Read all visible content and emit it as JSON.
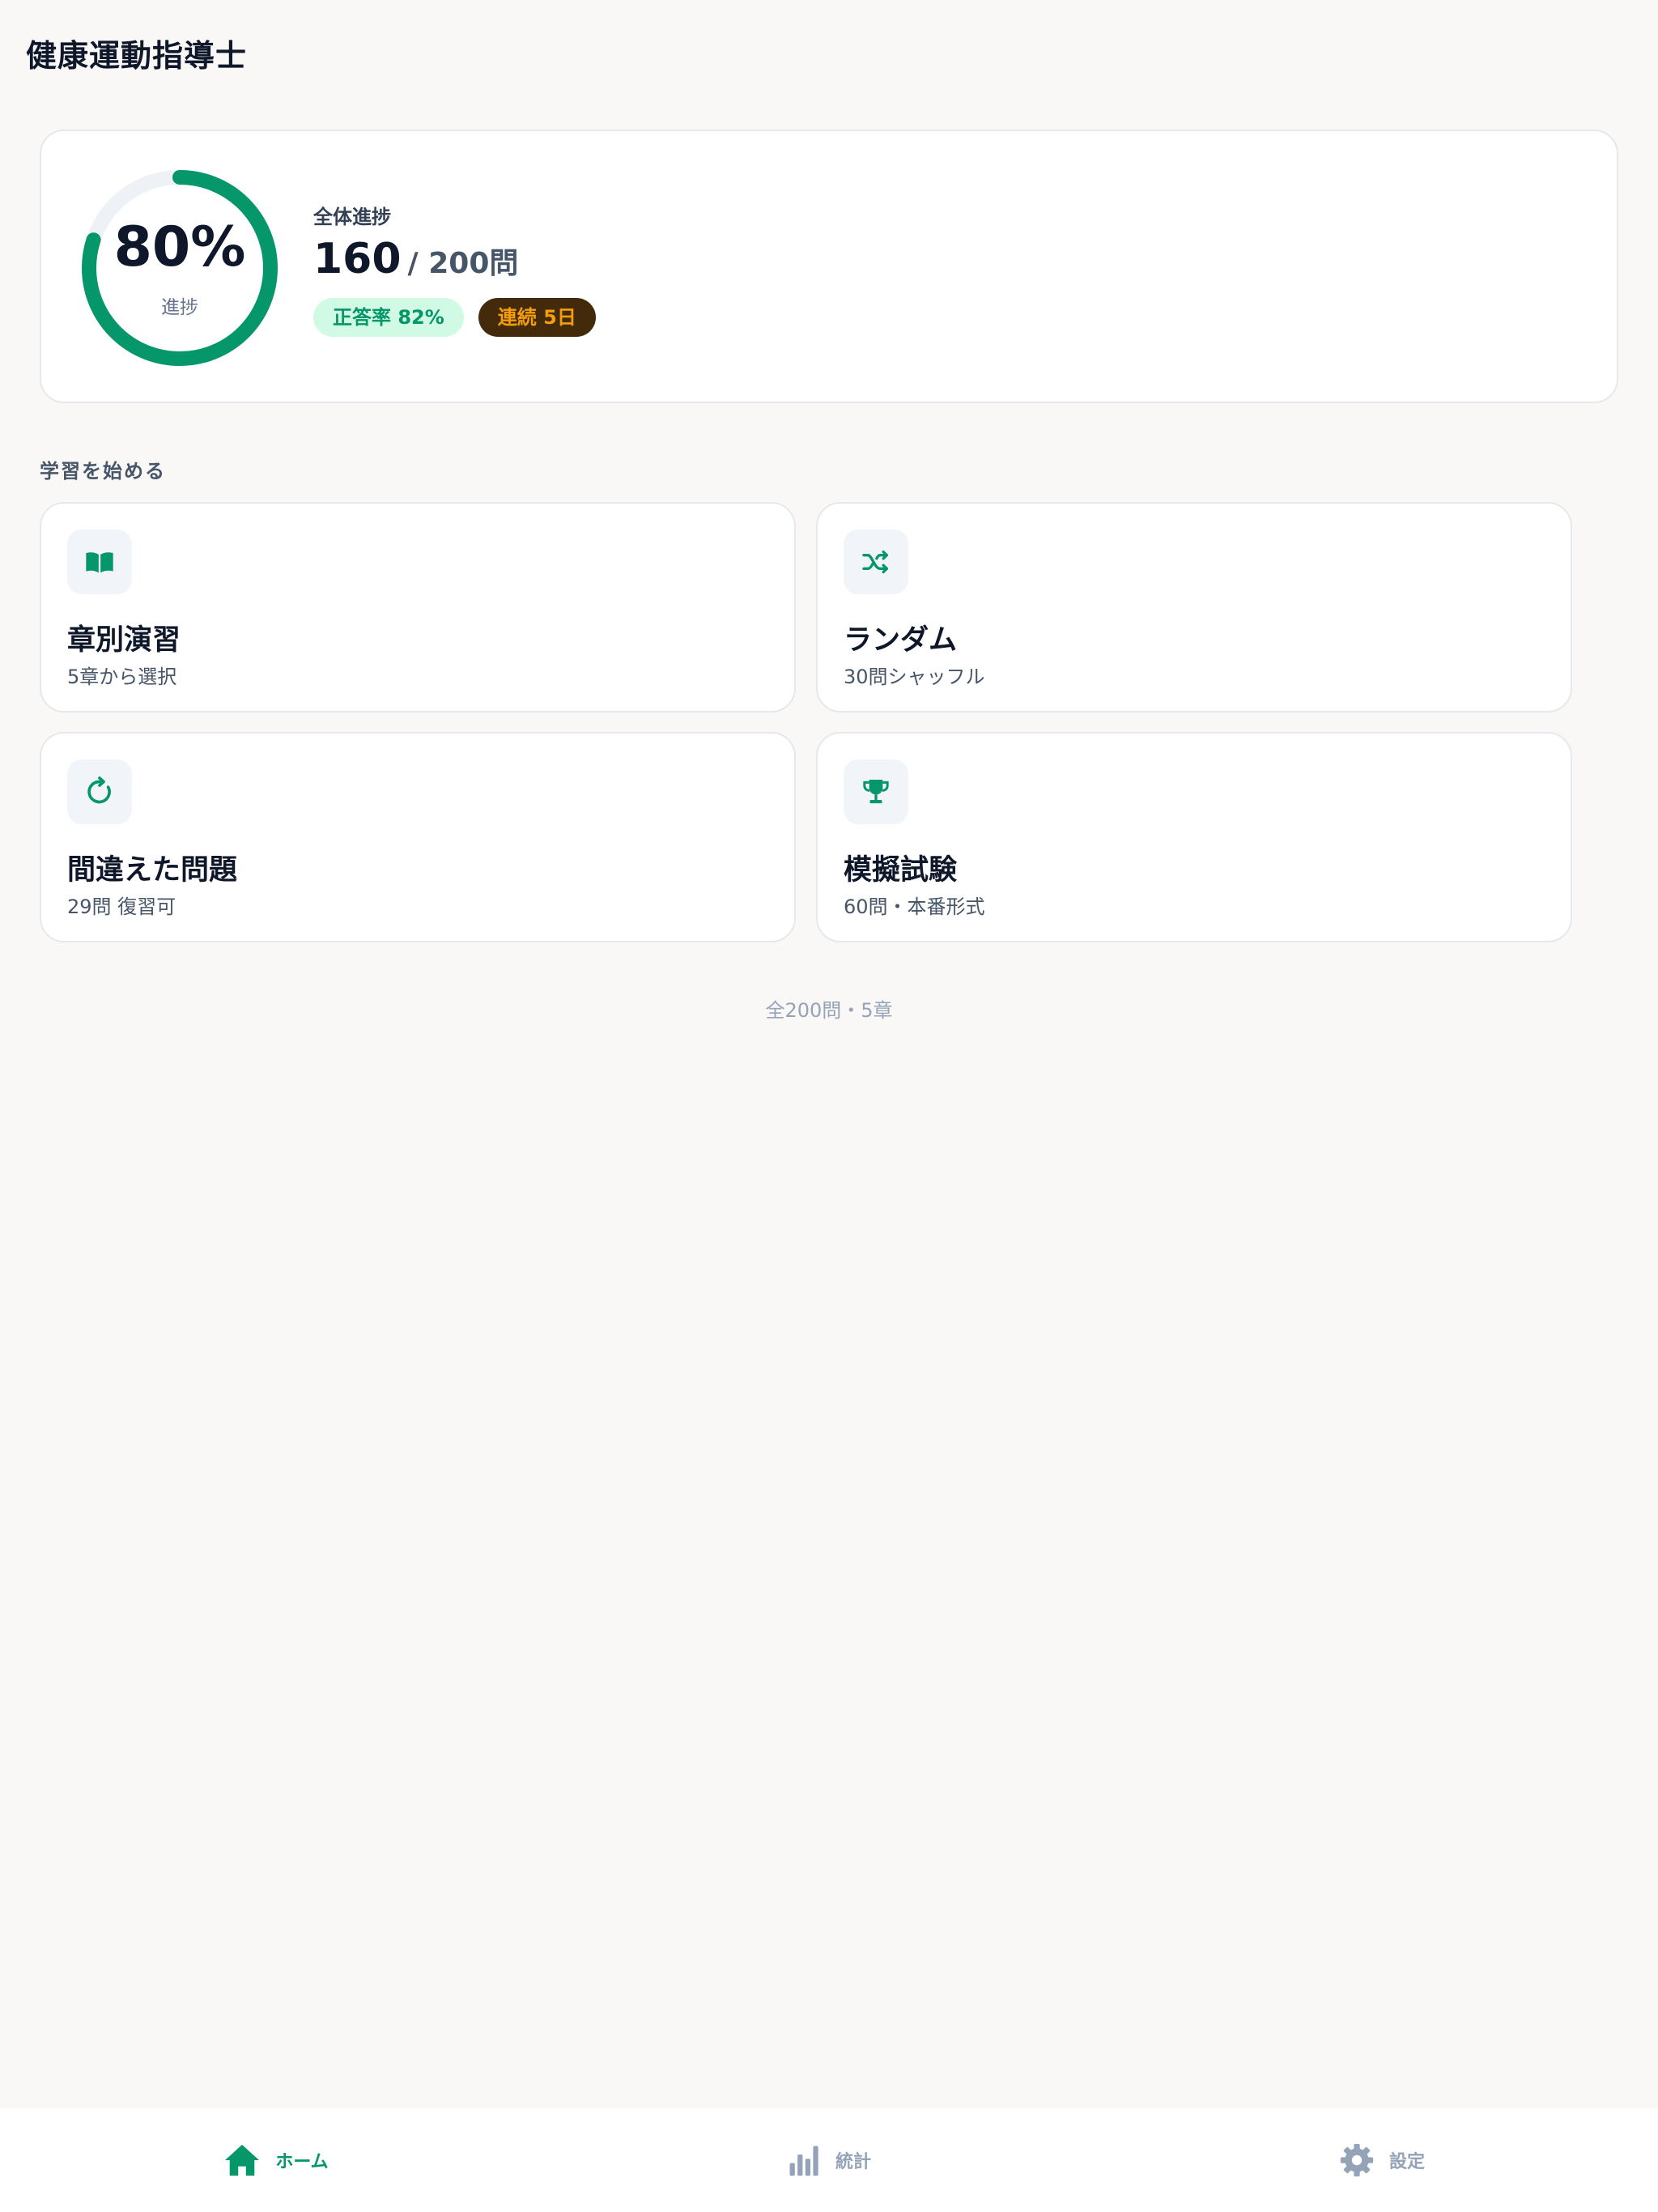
{
  "header": {
    "title": "健康運動指導士"
  },
  "progress": {
    "percent_text": "80%",
    "percent_value": 0.8,
    "ring_label": "進捗",
    "overall_label": "全体進捗",
    "done": "160",
    "total": "/ 200問",
    "accuracy_badge": "正答率 82%",
    "streak_badge": "連続 5日"
  },
  "section": {
    "title": "学習を始める"
  },
  "modes": [
    {
      "title": "章別演習",
      "subtitle": "5章から選択",
      "icon": "book-icon"
    },
    {
      "title": "ランダム",
      "subtitle": "30問シャッフル",
      "icon": "shuffle-icon"
    },
    {
      "title": "間違えた問題",
      "subtitle": "29問 復習可",
      "icon": "refresh-icon"
    },
    {
      "title": "模擬試験",
      "subtitle": "60問・本番形式",
      "icon": "trophy-icon"
    }
  ],
  "footer_note": "全200問・5章",
  "tabs": [
    {
      "label": "ホーム",
      "icon": "home-icon",
      "active": true
    },
    {
      "label": "統計",
      "icon": "bar-chart-icon",
      "active": false
    },
    {
      "label": "設定",
      "icon": "gear-icon",
      "active": false
    }
  ],
  "colors": {
    "accent": "#059669",
    "ring_track": "#eef2f6",
    "streak_bg": "#422a0a",
    "streak_text": "#f59e0b",
    "inactive": "#94a3b8"
  }
}
